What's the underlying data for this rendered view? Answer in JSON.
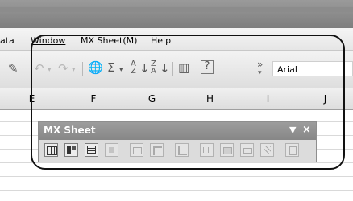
{
  "menu": {
    "items": [
      "ata",
      "Window",
      "MX Sheet(M)",
      "Help"
    ]
  },
  "toolbar": {
    "font_name": "Arial",
    "icons": [
      "brush-icon",
      "undo-icon",
      "undo-dropdown-icon",
      "redo-icon",
      "redo-dropdown-icon",
      "hyperlink-icon",
      "autosum-icon",
      "autosum-dropdown-icon",
      "sort-ascending-icon",
      "sort-descending-icon",
      "chart-wizard-icon",
      "help-icon",
      "toolbar-options-icon"
    ]
  },
  "sheet": {
    "columns": [
      "E",
      "F",
      "G",
      "H",
      "I",
      "J"
    ]
  },
  "mx_panel": {
    "title": "MX Sheet",
    "menu_glyph": "▼",
    "close_glyph": "×",
    "buttons": [
      {
        "icon": "table-icon",
        "enabled": true
      },
      {
        "icon": "grid-icon",
        "enabled": true
      },
      {
        "icon": "sheet-icon",
        "enabled": true
      },
      {
        "icon": "disabled-tool-1-icon",
        "enabled": false
      },
      {
        "icon": "disabled-tool-2-icon",
        "enabled": false
      },
      {
        "icon": "disabled-tool-3-icon",
        "enabled": false
      },
      {
        "icon": "disabled-tool-4-icon",
        "enabled": false
      },
      {
        "icon": "disabled-tool-5-icon",
        "enabled": false
      },
      {
        "icon": "disabled-tool-6-icon",
        "enabled": false
      },
      {
        "icon": "disabled-tool-7-icon",
        "enabled": false
      },
      {
        "icon": "disabled-tool-8-icon",
        "enabled": false
      },
      {
        "icon": "disabled-tool-9-icon",
        "enabled": false
      }
    ]
  }
}
